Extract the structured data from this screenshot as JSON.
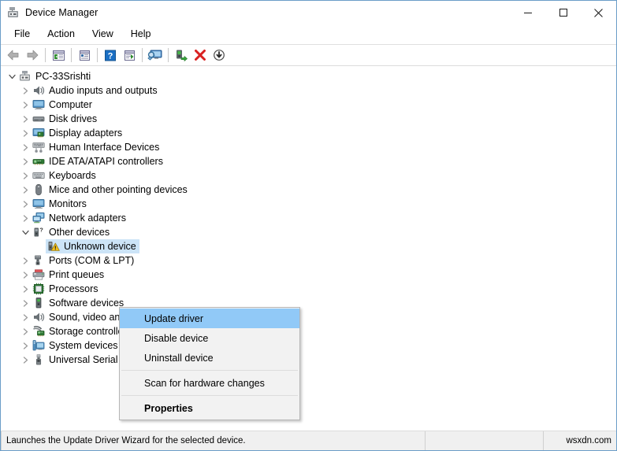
{
  "window": {
    "title": "Device Manager",
    "title_icon": "device-manager-icon",
    "minimize_label": "Minimize",
    "maximize_label": "Maximize",
    "close_label": "Close"
  },
  "menubar": {
    "items": [
      {
        "label": "File",
        "name": "menu-file"
      },
      {
        "label": "Action",
        "name": "menu-action"
      },
      {
        "label": "View",
        "name": "menu-view"
      },
      {
        "label": "Help",
        "name": "menu-help"
      }
    ]
  },
  "toolbar": {
    "buttons": [
      {
        "icon": "back-arrow-icon",
        "tooltip": "Back"
      },
      {
        "icon": "forward-arrow-icon",
        "tooltip": "Forward"
      },
      {
        "icon": "show-hide-console-tree-icon",
        "tooltip": "Show/hide console tree"
      },
      {
        "icon": "properties-icon",
        "tooltip": "Properties"
      },
      {
        "icon": "help-icon",
        "tooltip": "Help"
      },
      {
        "icon": "scan-hardware-changes-icon",
        "tooltip": "Scan for hardware changes"
      },
      {
        "icon": "update-driver-icon",
        "tooltip": "Update driver"
      },
      {
        "icon": "enable-device-icon",
        "tooltip": "Enable device"
      },
      {
        "icon": "uninstall-device-icon",
        "tooltip": "Uninstall device"
      },
      {
        "icon": "disable-device-icon",
        "tooltip": "Disable device"
      }
    ]
  },
  "tree": {
    "root": {
      "label": "PC-33Srishti",
      "icon": "computer-root-icon",
      "expanded": true
    },
    "nodes": [
      {
        "label": "Audio inputs and outputs",
        "icon": "speaker-icon",
        "expanded": false,
        "selected": false
      },
      {
        "label": "Computer",
        "icon": "monitor-icon",
        "expanded": false,
        "selected": false
      },
      {
        "label": "Disk drives",
        "icon": "disk-drive-icon",
        "expanded": false,
        "selected": false
      },
      {
        "label": "Display adapters",
        "icon": "display-adapter-icon",
        "expanded": false,
        "selected": false
      },
      {
        "label": "Human Interface Devices",
        "icon": "hid-icon",
        "expanded": false,
        "selected": false
      },
      {
        "label": "IDE ATA/ATAPI controllers",
        "icon": "ide-controller-icon",
        "expanded": false,
        "selected": false
      },
      {
        "label": "Keyboards",
        "icon": "keyboard-icon",
        "expanded": false,
        "selected": false
      },
      {
        "label": "Mice and other pointing devices",
        "icon": "mouse-icon",
        "expanded": false,
        "selected": false
      },
      {
        "label": "Monitors",
        "icon": "monitor-icon",
        "expanded": false,
        "selected": false
      },
      {
        "label": "Network adapters",
        "icon": "network-adapter-icon",
        "expanded": false,
        "selected": false
      },
      {
        "label": "Other devices",
        "icon": "other-devices-icon",
        "expanded": true,
        "selected": false
      },
      {
        "label": "Unknown device",
        "icon": "unknown-device-warning-icon",
        "expanded": null,
        "selected": true,
        "child": true
      },
      {
        "label": "Ports (COM & LPT)",
        "icon": "port-icon",
        "expanded": false,
        "selected": false
      },
      {
        "label": "Print queues",
        "icon": "printer-icon",
        "expanded": false,
        "selected": false
      },
      {
        "label": "Processors",
        "icon": "processor-icon",
        "expanded": false,
        "selected": false
      },
      {
        "label": "Software devices",
        "icon": "software-device-icon",
        "expanded": false,
        "selected": false
      },
      {
        "label": "Sound, video and game controllers",
        "icon": "speaker-icon",
        "expanded": false,
        "selected": false
      },
      {
        "label": "Storage controllers",
        "icon": "storage-controller-icon",
        "expanded": false,
        "selected": false
      },
      {
        "label": "System devices",
        "icon": "system-device-icon",
        "expanded": false,
        "selected": false
      },
      {
        "label": "Universal Serial Bus controllers",
        "icon": "usb-controller-icon",
        "expanded": false,
        "selected": false
      }
    ]
  },
  "context_menu": {
    "items": [
      {
        "label": "Update driver",
        "highlighted": true,
        "bold": false,
        "separator_after": false
      },
      {
        "label": "Disable device",
        "highlighted": false,
        "bold": false,
        "separator_after": false
      },
      {
        "label": "Uninstall device",
        "highlighted": false,
        "bold": false,
        "separator_after": true
      },
      {
        "label": "Scan for hardware changes",
        "highlighted": false,
        "bold": false,
        "separator_after": true
      },
      {
        "label": "Properties",
        "highlighted": false,
        "bold": true,
        "separator_after": false
      }
    ]
  },
  "statusbar": {
    "message": "Launches the Update Driver Wizard for the selected device.",
    "middle": "",
    "watermark": "wsxdn.com"
  },
  "colors": {
    "window_border": "#6b9dc8",
    "selection": "#cce4f7",
    "menu_highlight": "#91c9f7",
    "statusbar_bg": "#f0f0f0",
    "context_menu_bg": "#f2f2f2"
  }
}
